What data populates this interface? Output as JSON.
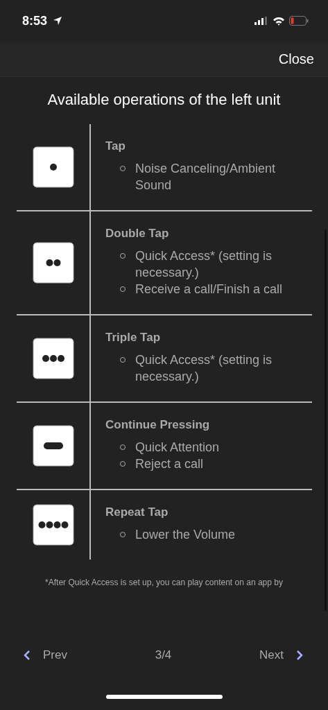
{
  "status_bar": {
    "time": "8:53"
  },
  "header": {
    "close": "Close"
  },
  "title": "Available operations of the left unit",
  "operations": [
    {
      "kind": "single",
      "name": "Tap",
      "items": [
        "Noise Canceling/Ambient Sound"
      ]
    },
    {
      "kind": "double",
      "name": "Double Tap",
      "items": [
        "Quick Access* (setting is necessary.)",
        "Receive a call/Finish a call"
      ]
    },
    {
      "kind": "triple",
      "name": "Triple Tap",
      "items": [
        "Quick Access* (setting is necessary.)"
      ]
    },
    {
      "kind": "hold",
      "name": "Continue Pressing",
      "items": [
        "Quick Attention",
        "Reject a call"
      ]
    },
    {
      "kind": "repeat",
      "name": "Repeat Tap",
      "items": [
        "Lower the Volume"
      ]
    }
  ],
  "footnote": "*After Quick Access is set up, you can play content on an app by",
  "footer": {
    "prev": "Prev",
    "page": "3/4",
    "next": "Next"
  }
}
